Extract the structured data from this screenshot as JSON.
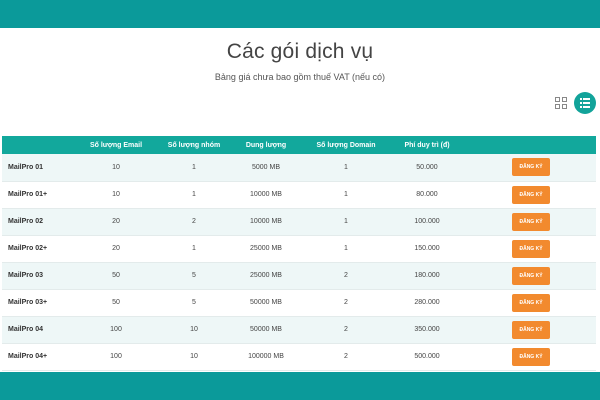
{
  "header": {
    "title": "Các gói dịch vụ",
    "subtitle": "Bảng giá chưa bao gồm thuế VAT (nếu có)"
  },
  "view_toggle": {
    "grid_icon": "grid-view-icon",
    "list_icon": "list-view-icon",
    "active": "list",
    "accent": "#12a39a"
  },
  "table": {
    "columns": [
      "",
      "Số lượng Email",
      "Số lượng nhóm",
      "Dung lượng",
      "Số lượng Domain",
      "Phí duy trì (đ)",
      ""
    ],
    "rows": [
      {
        "name": "MailPro 01",
        "email": "10",
        "groups": "1",
        "storage": "5000 MB",
        "domains": "1",
        "fee": "50.000",
        "action": "ĐĂNG KÝ"
      },
      {
        "name": "MailPro 01+",
        "email": "10",
        "groups": "1",
        "storage": "10000 MB",
        "domains": "1",
        "fee": "80.000",
        "action": "ĐĂNG KÝ"
      },
      {
        "name": "MailPro 02",
        "email": "20",
        "groups": "2",
        "storage": "10000 MB",
        "domains": "1",
        "fee": "100.000",
        "action": "ĐĂNG KÝ"
      },
      {
        "name": "MailPro 02+",
        "email": "20",
        "groups": "1",
        "storage": "25000 MB",
        "domains": "1",
        "fee": "150.000",
        "action": "ĐĂNG KÝ"
      },
      {
        "name": "MailPro 03",
        "email": "50",
        "groups": "5",
        "storage": "25000 MB",
        "domains": "2",
        "fee": "180.000",
        "action": "ĐĂNG KÝ"
      },
      {
        "name": "MailPro 03+",
        "email": "50",
        "groups": "5",
        "storage": "50000 MB",
        "domains": "2",
        "fee": "280.000",
        "action": "ĐĂNG KÝ"
      },
      {
        "name": "MailPro 04",
        "email": "100",
        "groups": "10",
        "storage": "50000 MB",
        "domains": "2",
        "fee": "350.000",
        "action": "ĐĂNG KÝ"
      },
      {
        "name": "MailPro 04+",
        "email": "100",
        "groups": "10",
        "storage": "100000 MB",
        "domains": "2",
        "fee": "500.000",
        "action": "ĐĂNG KÝ"
      }
    ]
  },
  "colors": {
    "frame": "#0b9a9a",
    "header_row": "#12a89c",
    "button": "#f28a2e"
  }
}
